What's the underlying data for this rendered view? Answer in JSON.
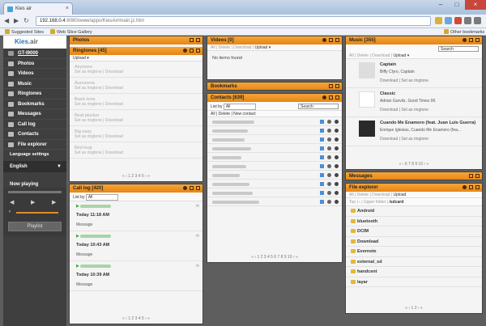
{
  "browser": {
    "tab_title": "Kies air",
    "url_host": "192.168.0.4",
    "url_rest": ":8080/www/apps/KiesAir/main.jz.htm",
    "bookmarks": [
      "Suggested Sites",
      "Web Slice Gallery"
    ],
    "other_bookmarks": "Other bookmarks",
    "window_controls": [
      "–",
      "□",
      "×"
    ]
  },
  "sidebar": {
    "logo_a": "Kies",
    "logo_b": ".air",
    "device": "GT-I9000",
    "items": [
      {
        "label": "Photos",
        "icon": "photo-icon"
      },
      {
        "label": "Videos",
        "icon": "video-icon"
      },
      {
        "label": "Music",
        "icon": "music-icon"
      },
      {
        "label": "Ringtones",
        "icon": "bell-icon"
      },
      {
        "label": "Bookmarks",
        "icon": "bookmark-icon"
      },
      {
        "label": "Messages",
        "icon": "message-icon"
      },
      {
        "label": "Call log",
        "icon": "phone-icon"
      },
      {
        "label": "Contacts",
        "icon": "contacts-icon"
      },
      {
        "label": "File explorer",
        "icon": "folder-icon"
      }
    ],
    "language_settings": "Language settings",
    "language": "English",
    "now_playing": "Now playing",
    "playlist": "Playlist"
  },
  "photos": {
    "title": "Photos"
  },
  "ringtones": {
    "title": "Ringtones [45]",
    "upload": "Upload ▾",
    "set_label": "Set as ringtone",
    "download": "Download",
    "items": [
      "Airymore",
      "Aurosonia",
      "Basic tone",
      "Beat plucker",
      "Big easy",
      "Bird loop"
    ],
    "pager": "«  ‹  1 2 3 4 5  ›  »"
  },
  "videos": {
    "title": "Videos [0]",
    "toolbar": "All | Delete | Download | ",
    "upload": "Upload ▾",
    "empty": "No items found"
  },
  "bookmarks": {
    "title": "Bookmarks"
  },
  "contacts": {
    "title": "Contacts [639]",
    "list_by": "List by",
    "select": "All",
    "search": "Search",
    "toolbar": "All | Delete | New contact",
    "pager": "«  ‹  1 2 3 4 5 6 7 8 9 10  ›  »"
  },
  "call_log": {
    "title": "Call log [420]",
    "list_by": "List by",
    "select": "All",
    "entries": [
      {
        "time": "Today 11:18 AM",
        "type": "Message"
      },
      {
        "time": "Today 10:43 AM",
        "type": "Message"
      },
      {
        "time": "Today 10:39 AM",
        "type": "Message"
      }
    ],
    "pager": "«  ‹  1 2 3 4 5  ›  »"
  },
  "music": {
    "title": "Music [355]",
    "search": "Search",
    "toolbar": "All | Delete | Download | ",
    "upload": "Upload ▾",
    "tracks": [
      {
        "title": "Captain",
        "subtitle": "Biffy Clyro, Captain"
      },
      {
        "title": "Classic",
        "subtitle": "Adrian Gurvitz, Good Times 96"
      },
      {
        "title": "Cuando Me Enamoro (feat. Juan Luis Guerra)",
        "subtitle": "Enrique Iglesias, Cuando Me Enamoro (fea..."
      }
    ],
    "download": "Download",
    "set_label": "Set as ringtone",
    "pager": "«  ‹  6 7 8 9 10  ›  »"
  },
  "messages": {
    "title": "Messages"
  },
  "file_explorer": {
    "title": "File explorer",
    "toolbar": "All | Delete | Download | ",
    "upload": "Upload",
    "path_prefix": "Top | ‹ | Upper folder | ",
    "path": "/sdcard",
    "folders": [
      "Android",
      "bluetooth",
      "DCIM",
      "Download",
      "Evernote",
      "external_sd",
      "handcent",
      "layar"
    ],
    "pager": "«  ‹  1 2  ›  »"
  },
  "colors": {
    "accent": "#f0921e",
    "sidebar": "#3f3f3f"
  }
}
